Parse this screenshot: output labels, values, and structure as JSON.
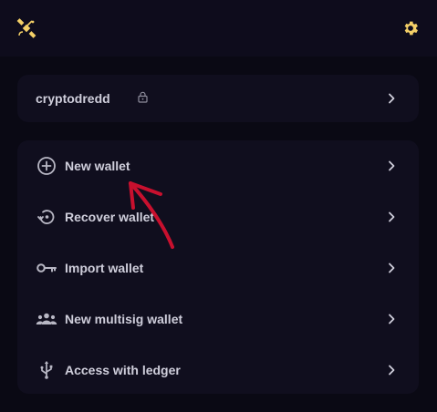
{
  "header": {
    "logo_icon": "satellite-icon",
    "settings_icon": "gear-icon",
    "accent": "#f4d067"
  },
  "account": {
    "name": "cryptodredd",
    "lock_icon": "lock-icon"
  },
  "menu": {
    "items": [
      {
        "label": "New wallet",
        "icon": "plus-circle-icon"
      },
      {
        "label": "Recover wallet",
        "icon": "restore-icon"
      },
      {
        "label": "Import wallet",
        "icon": "key-icon"
      },
      {
        "label": "New multisig wallet",
        "icon": "group-icon"
      },
      {
        "label": "Access with ledger",
        "icon": "usb-icon"
      }
    ]
  },
  "annotation_color": "#c8102e"
}
